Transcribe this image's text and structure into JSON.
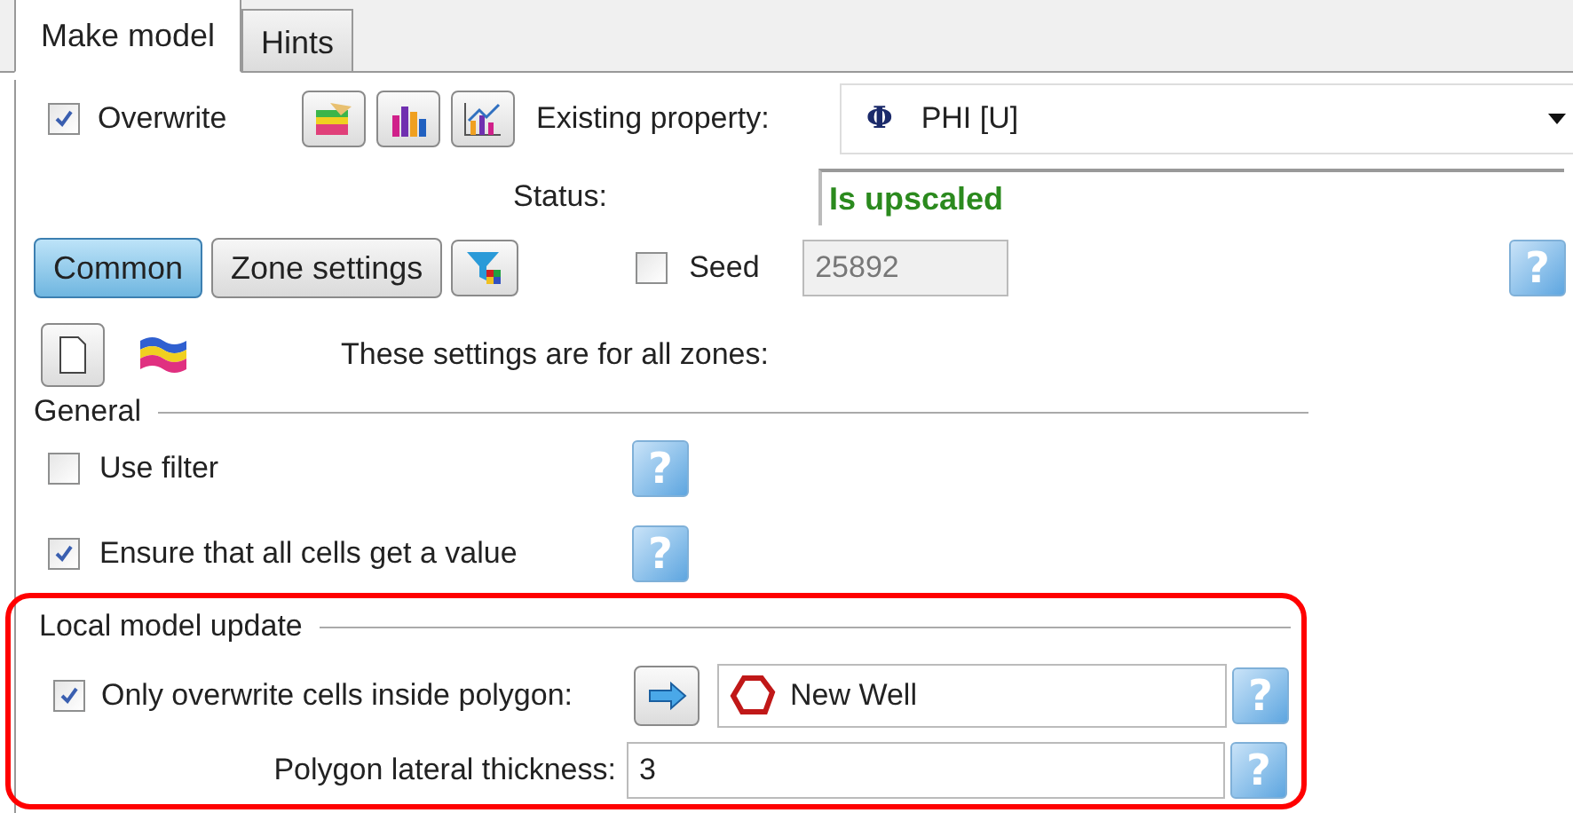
{
  "tabs": [
    {
      "label": "Make model",
      "selected": true
    },
    {
      "label": "Hints",
      "selected": false
    }
  ],
  "overwrite": {
    "label": "Overwrite",
    "checked": true
  },
  "existing_property": {
    "label": "Existing property:",
    "symbol": "Φ",
    "value": "PHI [U]"
  },
  "status": {
    "label": "Status:",
    "value": "Is upscaled"
  },
  "mode_buttons": [
    {
      "label": "Common",
      "selected": true
    },
    {
      "label": "Zone settings",
      "selected": false
    }
  ],
  "seed": {
    "label": "Seed",
    "checked": false,
    "value": "25892",
    "disabled": true,
    "help": "?"
  },
  "zones_note": "These settings are for all zones:",
  "general": {
    "title": "General",
    "options": [
      {
        "label": "Use filter",
        "checked": false,
        "help": "?"
      },
      {
        "label": "Ensure that all cells get a value",
        "checked": true,
        "help": "?"
      }
    ]
  },
  "local_update": {
    "title": "Local model update",
    "highlighted": true,
    "polygon": {
      "label": "Only overwrite cells inside polygon:",
      "checked": true,
      "value": "New Well",
      "help": "?"
    },
    "thickness": {
      "label": "Polygon lateral thickness:",
      "value": "3",
      "help": "?"
    }
  }
}
